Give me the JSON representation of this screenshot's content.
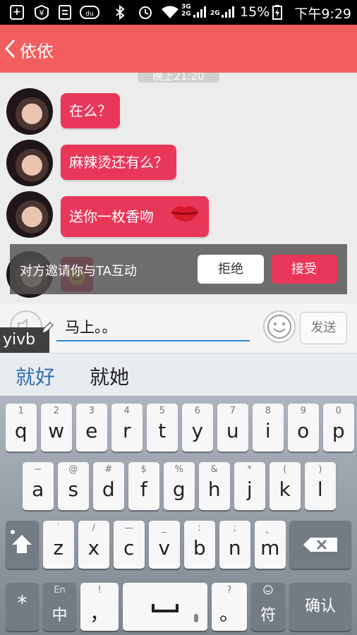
{
  "status_bar": {
    "battery": "15%",
    "time": "下午9:29",
    "network_1": "3G",
    "network_2": "2G",
    "network_3": "2G"
  },
  "header": {
    "title": "依依"
  },
  "chat": {
    "timestamp": "晚上21:20",
    "messages": [
      {
        "text": "在么？"
      },
      {
        "text": "麻辣烫还有么？"
      },
      {
        "text": "送你一枚香吻"
      }
    ]
  },
  "invite": {
    "text": "对方邀请你与TA互动",
    "reject": "拒绝",
    "accept": "接受"
  },
  "input": {
    "value": "马上。。",
    "send": "发送",
    "pinyin": "yivb"
  },
  "candidates": [
    "就好",
    "就她"
  ],
  "keyboard": {
    "row1": [
      {
        "sub": "1",
        "main": "q"
      },
      {
        "sub": "2",
        "main": "w"
      },
      {
        "sub": "3",
        "main": "e"
      },
      {
        "sub": "4",
        "main": "r"
      },
      {
        "sub": "5",
        "main": "t"
      },
      {
        "sub": "6",
        "main": "y"
      },
      {
        "sub": "7",
        "main": "u"
      },
      {
        "sub": "8",
        "main": "i"
      },
      {
        "sub": "9",
        "main": "o"
      },
      {
        "sub": "0",
        "main": "p"
      }
    ],
    "row2": [
      {
        "sub": "~",
        "main": "a"
      },
      {
        "sub": "@",
        "main": "s"
      },
      {
        "sub": "#",
        "main": "d"
      },
      {
        "sub": "$",
        "main": "f"
      },
      {
        "sub": "%",
        "main": "g"
      },
      {
        "sub": "&",
        "main": "h"
      },
      {
        "sub": "*",
        "main": "j"
      },
      {
        "sub": "(",
        "main": "k"
      },
      {
        "sub": ")",
        "main": "l"
      }
    ],
    "row3": [
      {
        "sub": "′",
        "main": "z"
      },
      {
        "sub": "/",
        "main": "x"
      },
      {
        "sub": "—",
        "main": "c"
      },
      {
        "sub": "_",
        "main": "v"
      },
      {
        "sub": ":",
        "main": "b"
      },
      {
        "sub": ";",
        "main": "n"
      },
      {
        "sub": "、",
        "main": "m"
      }
    ],
    "row4": {
      "sym": "*",
      "lang_sub": "En",
      "lang_main": "中",
      "comma_sub": "!",
      "comma_main": "，",
      "period_sub": "?",
      "period_main": "。",
      "fu_main": "符",
      "confirm": "确认"
    }
  },
  "colors": {
    "header": "#f25e5e",
    "bubble": "#e9375a",
    "accent": "#2f6db4"
  }
}
